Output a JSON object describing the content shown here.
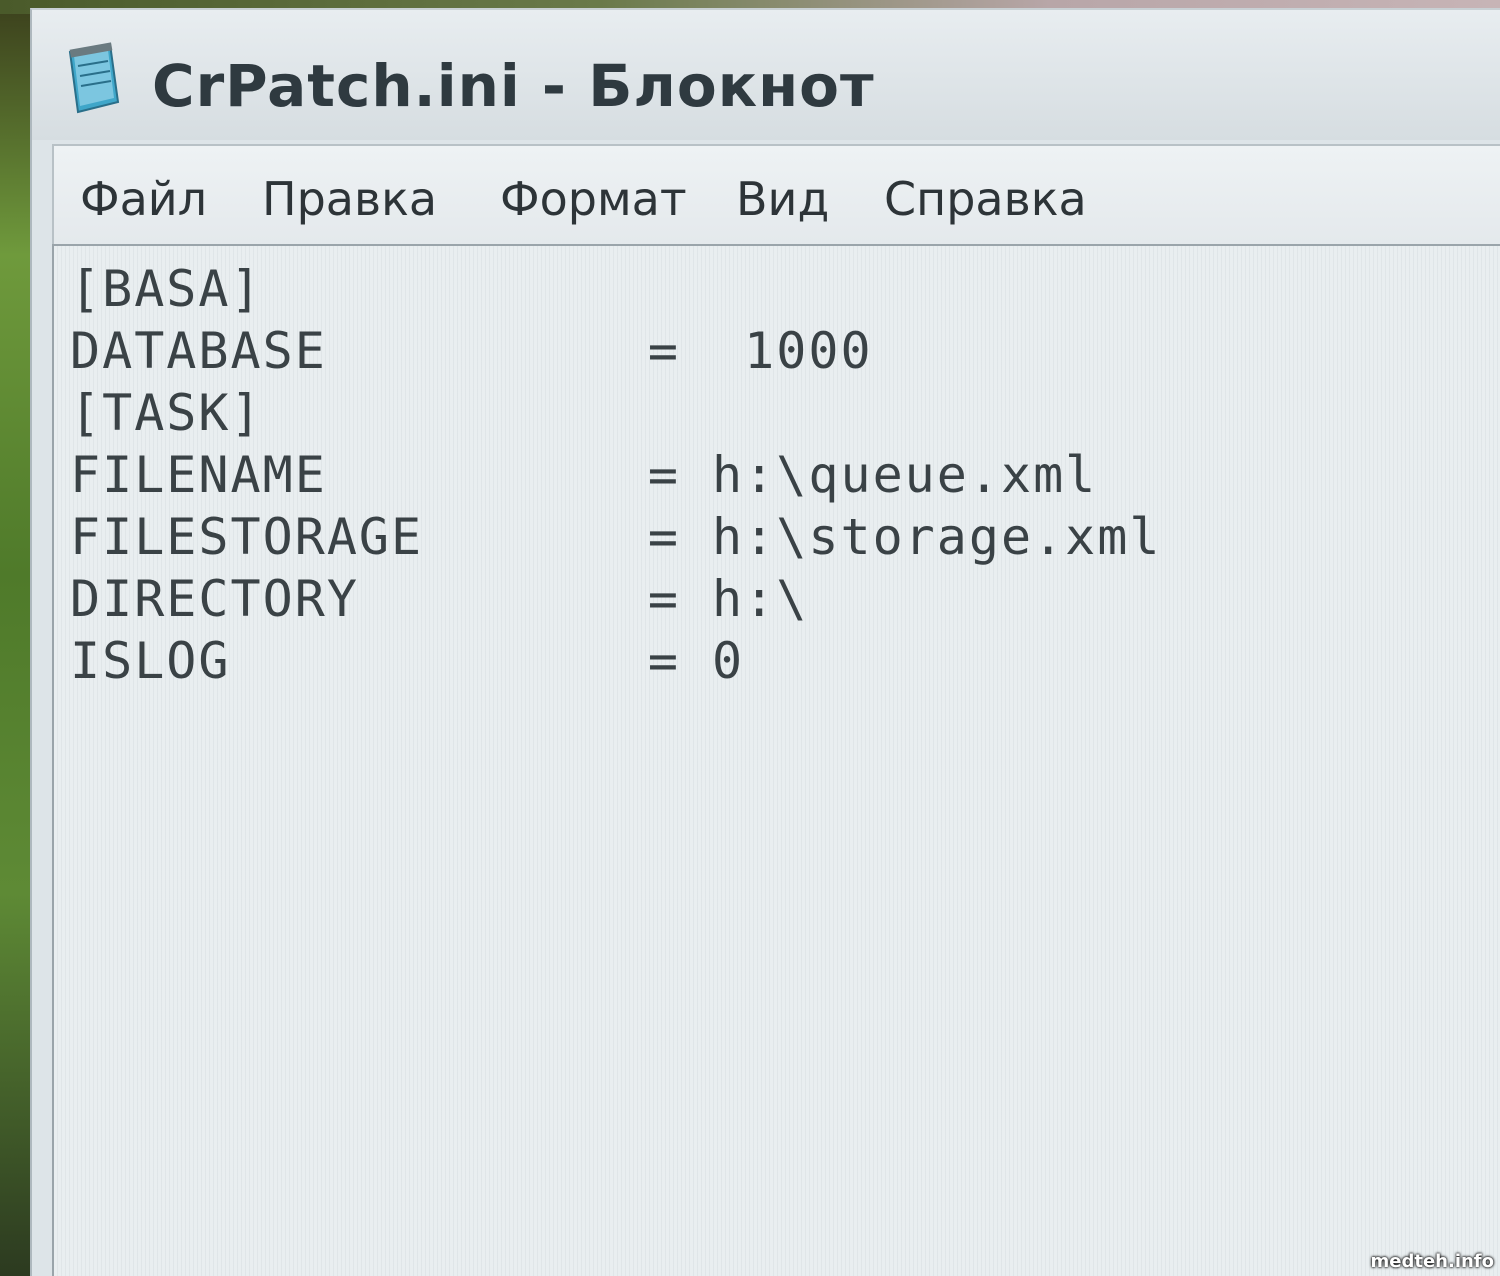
{
  "window": {
    "title": "CrPatch.ini - Блокнот",
    "icon": "notepad-icon"
  },
  "menu": {
    "items": [
      {
        "label": "Файл"
      },
      {
        "label": "Правка"
      },
      {
        "label": "Формат"
      },
      {
        "label": "Вид"
      },
      {
        "label": "Справка"
      }
    ]
  },
  "editor": {
    "content": "[BASA]\nDATABASE          =  1000\n[TASK]\nFILENAME          = h:\\queue.xml\nFILESTORAGE       = h:\\storage.xml\nDIRECTORY         = h:\\\nISLOG             = 0"
  },
  "watermark": "medteh.info"
}
